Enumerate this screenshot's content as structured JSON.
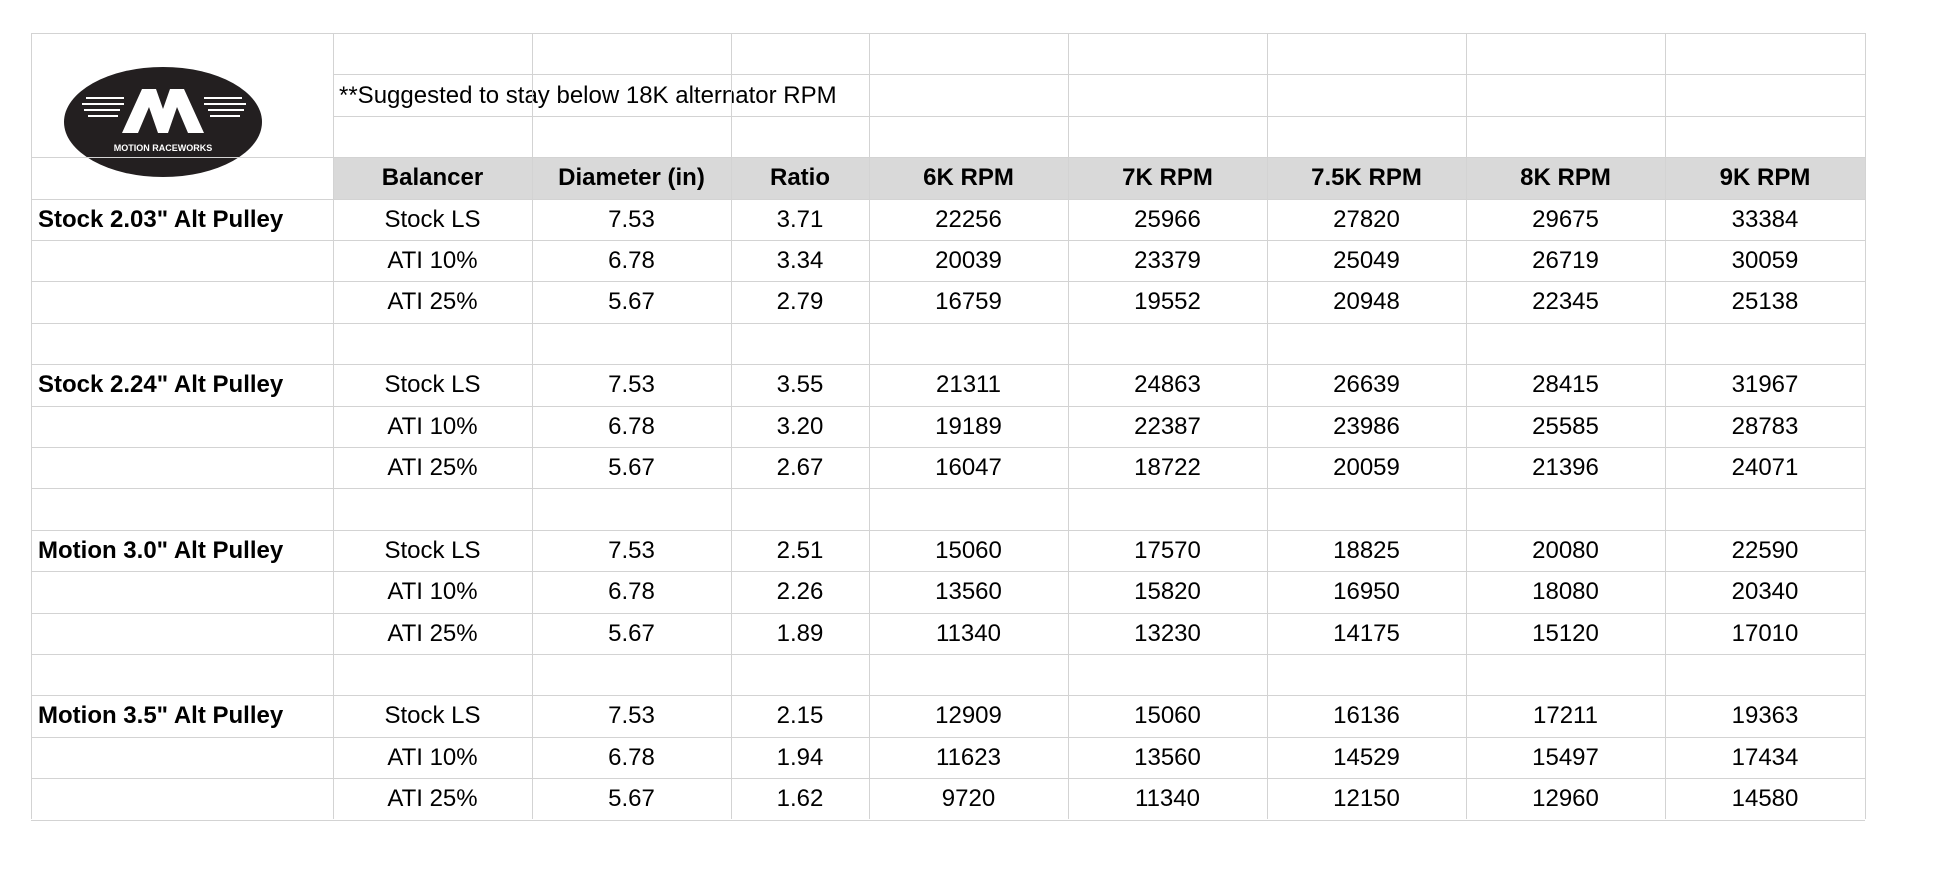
{
  "brand": {
    "logo_text": "MOTION RACEWORKS",
    "logo_letter": "M"
  },
  "note": "**Suggested to stay below 18K alternator RPM",
  "columns": [
    "Balancer",
    "Diameter (in)",
    "Ratio",
    "6K RPM",
    "7K RPM",
    "7.5K RPM",
    "8K RPM",
    "9K RPM"
  ],
  "groups": [
    {
      "title": "Stock 2.03\" Alt Pulley",
      "rows": [
        [
          "Stock LS",
          "7.53",
          "3.71",
          "22256",
          "25966",
          "27820",
          "29675",
          "33384"
        ],
        [
          "ATI 10%",
          "6.78",
          "3.34",
          "20039",
          "23379",
          "25049",
          "26719",
          "30059"
        ],
        [
          "ATI 25%",
          "5.67",
          "2.79",
          "16759",
          "19552",
          "20948",
          "22345",
          "25138"
        ]
      ]
    },
    {
      "title": "Stock 2.24\" Alt Pulley",
      "rows": [
        [
          "Stock LS",
          "7.53",
          "3.55",
          "21311",
          "24863",
          "26639",
          "28415",
          "31967"
        ],
        [
          "ATI 10%",
          "6.78",
          "3.20",
          "19189",
          "22387",
          "23986",
          "25585",
          "28783"
        ],
        [
          "ATI 25%",
          "5.67",
          "2.67",
          "16047",
          "18722",
          "20059",
          "21396",
          "24071"
        ]
      ]
    },
    {
      "title": "Motion 3.0\" Alt Pulley",
      "rows": [
        [
          "Stock LS",
          "7.53",
          "2.51",
          "15060",
          "17570",
          "18825",
          "20080",
          "22590"
        ],
        [
          "ATI 10%",
          "6.78",
          "2.26",
          "13560",
          "15820",
          "16950",
          "18080",
          "20340"
        ],
        [
          "ATI 25%",
          "5.67",
          "1.89",
          "11340",
          "13230",
          "14175",
          "15120",
          "17010"
        ]
      ]
    },
    {
      "title": "Motion 3.5\" Alt Pulley",
      "rows": [
        [
          "Stock LS",
          "7.53",
          "2.15",
          "12909",
          "15060",
          "16136",
          "17211",
          "19363"
        ],
        [
          "ATI 10%",
          "6.78",
          "1.94",
          "11623",
          "13560",
          "14529",
          "15497",
          "17434"
        ],
        [
          "ATI 25%",
          "5.67",
          "1.62",
          "9720",
          "11340",
          "12150",
          "12960",
          "14580"
        ]
      ]
    }
  ]
}
